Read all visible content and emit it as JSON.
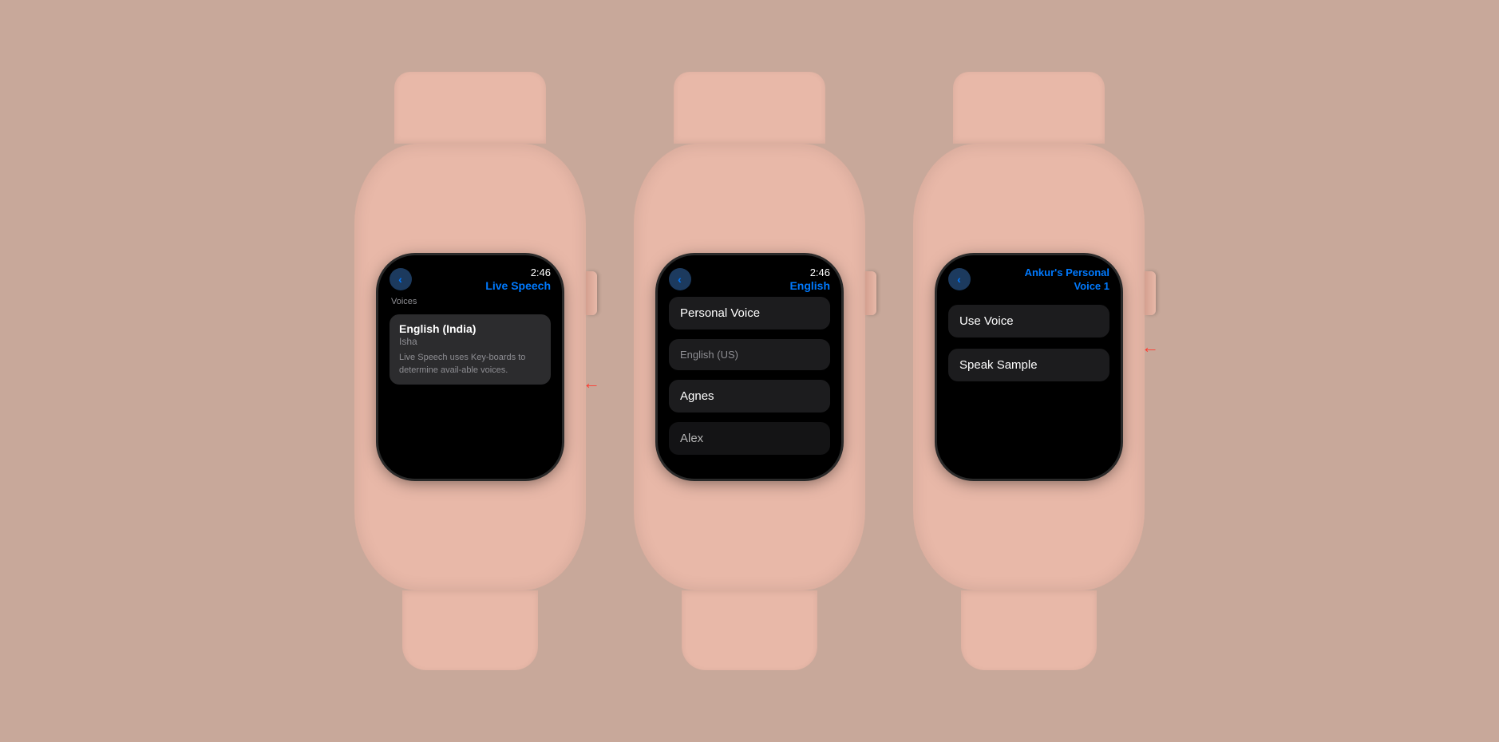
{
  "background": "#c8a89a",
  "watch1": {
    "time": "2:46",
    "title": "Live Speech",
    "back_label": "<",
    "section_voices": "Voices",
    "cell_title": "English (India)",
    "cell_subtitle": "Isha",
    "cell_description": "Live Speech uses Key-boards to determine avail-able voices.",
    "arrow": "←"
  },
  "watch2": {
    "time": "2:46",
    "title": "English",
    "back_label": "<",
    "cell1": "Personal Voice",
    "cell2": "English (US)",
    "cell3": "Agnes",
    "cell4": "Alex",
    "arrow": "←"
  },
  "watch3": {
    "title_line1": "Ankur's Personal",
    "title_line2": "Voice 1",
    "back_label": "<",
    "cell1": "Use Voice",
    "cell2": "Speak Sample",
    "arrow": "←"
  }
}
